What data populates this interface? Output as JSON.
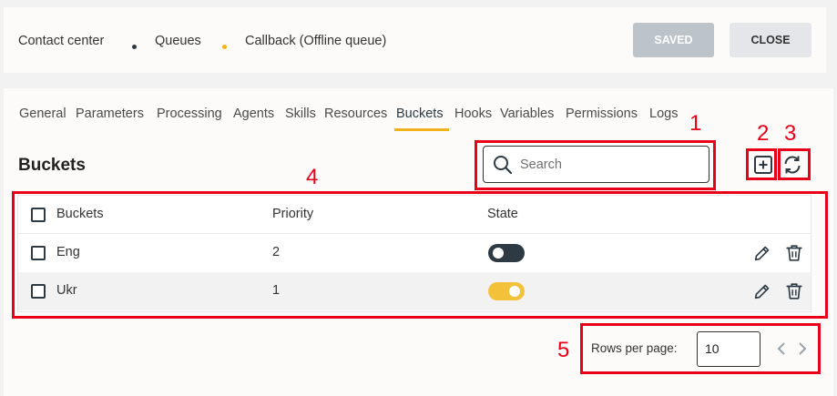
{
  "breadcrumb": {
    "items": [
      "Contact center",
      "Queues",
      "Callback (Offline queue)"
    ],
    "dot_colors": [
      "#2d3a44",
      "#f3b21b"
    ]
  },
  "header": {
    "saved_label": "SAVED",
    "close_label": "CLOSE"
  },
  "tabs": [
    "General",
    "Parameters",
    "Processing",
    "Agents",
    "Skills",
    "Resources",
    "Buckets",
    "Hooks",
    "Variables",
    "Permissions",
    "Logs"
  ],
  "active_tab": "Buckets",
  "section": {
    "title": "Buckets"
  },
  "search": {
    "placeholder": "Search",
    "value": ""
  },
  "table": {
    "columns": [
      "Buckets",
      "Priority",
      "State"
    ],
    "rows": [
      {
        "name": "Eng",
        "priority": "2",
        "state": "off"
      },
      {
        "name": "Ukr",
        "priority": "1",
        "state": "on"
      }
    ]
  },
  "pagination": {
    "rows_per_page_label": "Rows per page:",
    "rows_per_page_value": "10"
  },
  "annotations": [
    "1",
    "2",
    "3",
    "4",
    "5"
  ],
  "colors": {
    "accent": "#f3b21b",
    "dark": "#2d3a44",
    "annotation": "#e8001b",
    "saved_button": "#bcc4ca"
  },
  "icons": [
    "search-icon",
    "add-icon",
    "refresh-icon",
    "edit-icon",
    "delete-icon",
    "chevron-left-icon",
    "chevron-right-icon"
  ]
}
